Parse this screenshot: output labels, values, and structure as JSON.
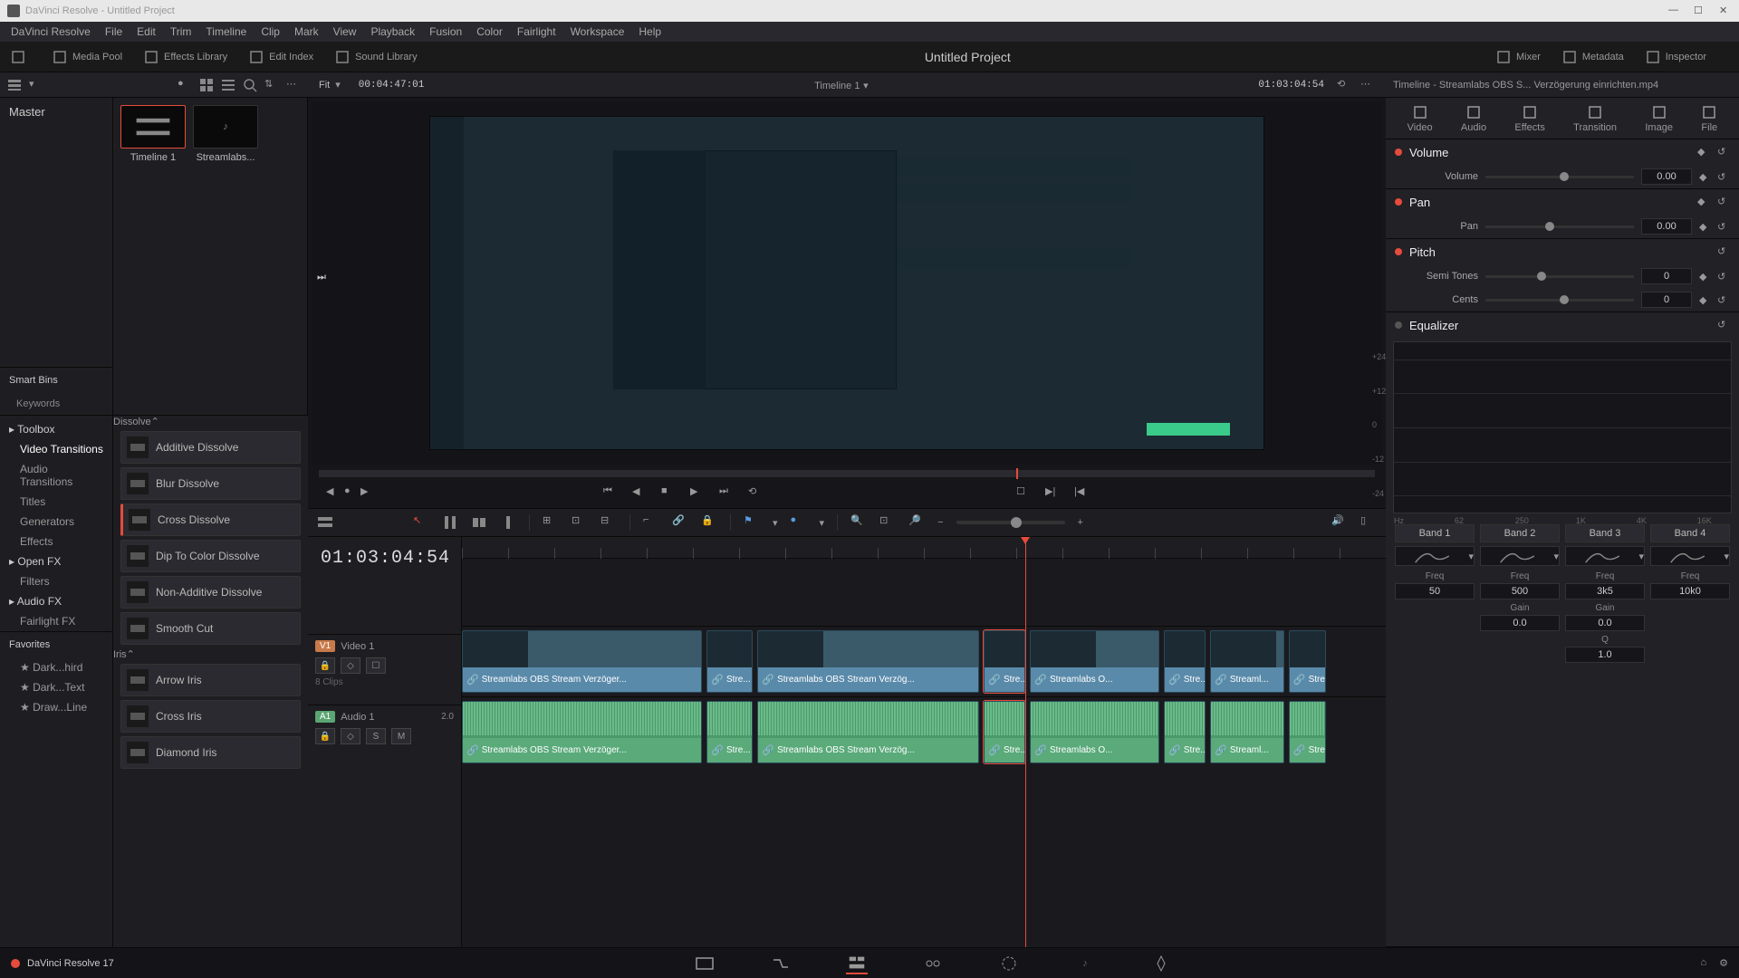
{
  "window": {
    "title": "DaVinci Resolve - Untitled Project"
  },
  "menubar": [
    "DaVinci Resolve",
    "File",
    "Edit",
    "Trim",
    "Timeline",
    "Clip",
    "Mark",
    "View",
    "Playback",
    "Fusion",
    "Color",
    "Fairlight",
    "Workspace",
    "Help"
  ],
  "topnav": {
    "left": [
      {
        "icon": "panel-left-icon",
        "label": ""
      },
      {
        "icon": "media-pool-icon",
        "label": "Media Pool"
      },
      {
        "icon": "effects-library-icon",
        "label": "Effects Library"
      },
      {
        "icon": "edit-index-icon",
        "label": "Edit Index"
      },
      {
        "icon": "sound-library-icon",
        "label": "Sound Library"
      }
    ],
    "project_title": "Untitled Project",
    "right": [
      {
        "icon": "mixer-icon",
        "label": "Mixer"
      },
      {
        "icon": "metadata-icon",
        "label": "Metadata"
      },
      {
        "icon": "inspector-icon",
        "label": "Inspector"
      }
    ]
  },
  "workrow": {
    "fit": "Fit",
    "source_tc": "00:04:47:01",
    "timeline_name": "Timeline 1",
    "record_tc": "01:03:04:54",
    "inspector_title": "Timeline - Streamlabs OBS S... Verzögerung einrichten.mp4"
  },
  "mediapool": {
    "master": "Master",
    "thumbs": [
      {
        "label": "Timeline 1",
        "selected": true
      },
      {
        "label": "Streamlabs..."
      }
    ],
    "smartbins": {
      "header": "Smart Bins",
      "items": [
        "Keywords"
      ]
    }
  },
  "fxlib": {
    "tree": [
      {
        "label": "Toolbox",
        "kind": "hdr"
      },
      {
        "label": "Video Transitions",
        "kind": "sub",
        "active": true
      },
      {
        "label": "Audio Transitions",
        "kind": "sub"
      },
      {
        "label": "Titles",
        "kind": "sub"
      },
      {
        "label": "Generators",
        "kind": "sub"
      },
      {
        "label": "Effects",
        "kind": "sub"
      },
      {
        "label": "Open FX",
        "kind": "hdr"
      },
      {
        "label": "Filters",
        "kind": "sub"
      },
      {
        "label": "Audio FX",
        "kind": "hdr"
      },
      {
        "label": "Fairlight FX",
        "kind": "sub"
      }
    ],
    "favorites_hdr": "Favorites",
    "favorites": [
      "Dark...hird",
      "Dark...Text",
      "Draw...Line"
    ],
    "groups": [
      {
        "name": "Dissolve",
        "items": [
          {
            "label": "Additive Dissolve"
          },
          {
            "label": "Blur Dissolve"
          },
          {
            "label": "Cross Dissolve",
            "selected": true
          },
          {
            "label": "Dip To Color Dissolve"
          },
          {
            "label": "Non-Additive Dissolve"
          },
          {
            "label": "Smooth Cut"
          }
        ]
      },
      {
        "name": "Iris",
        "items": [
          {
            "label": "Arrow Iris"
          },
          {
            "label": "Cross Iris"
          },
          {
            "label": "Diamond Iris"
          }
        ]
      }
    ]
  },
  "viewer": {
    "playhead_percent": 66
  },
  "timeline": {
    "big_tc": "01:03:04:54",
    "video_track": {
      "tag": "V1",
      "name": "Video 1",
      "clips_label": "8 Clips"
    },
    "audio_track": {
      "tag": "A1",
      "name": "Audio 1",
      "ch": "2.0"
    },
    "playhead_percent": 61,
    "clips": [
      {
        "start": 0,
        "width": 26,
        "label": "Streamlabs OBS Stream Verzöger..."
      },
      {
        "start": 26.5,
        "width": 5,
        "label": "Stre..."
      },
      {
        "start": 32,
        "width": 24,
        "label": "Streamlabs OBS Stream Verzög..."
      },
      {
        "start": 56.5,
        "width": 4.5,
        "label": "Stre...",
        "selected": true
      },
      {
        "start": 61.5,
        "width": 14,
        "label": "Streamlabs O..."
      },
      {
        "start": 76,
        "width": 4.5,
        "label": "Stre..."
      },
      {
        "start": 81,
        "width": 8,
        "label": "Streaml..."
      },
      {
        "start": 89.5,
        "width": 4,
        "label": "Stre..."
      }
    ]
  },
  "inspector": {
    "tabs": [
      {
        "icon": "video-tab-icon",
        "label": "Video"
      },
      {
        "icon": "audio-tab-icon",
        "label": "Audio",
        "active": true
      },
      {
        "icon": "effects-tab-icon",
        "label": "Effects"
      },
      {
        "icon": "transition-tab-icon",
        "label": "Transition"
      },
      {
        "icon": "image-tab-icon",
        "label": "Image"
      },
      {
        "icon": "file-tab-icon",
        "label": "File"
      }
    ],
    "volume": {
      "header": "Volume",
      "label": "Volume",
      "value": "0.00",
      "knob": 50
    },
    "pan": {
      "header": "Pan",
      "label": "Pan",
      "value": "0.00",
      "knob": 40
    },
    "pitch": {
      "header": "Pitch",
      "rows": [
        {
          "label": "Semi Tones",
          "value": "0",
          "knob": 35
        },
        {
          "label": "Cents",
          "value": "0",
          "knob": 50
        }
      ]
    },
    "equalizer": {
      "header": "Equalizer",
      "axis_left": [
        "+24",
        "+12",
        "0",
        "-12",
        "-24"
      ],
      "axis_bottom": [
        "Hz",
        "62",
        "250",
        "1K",
        "4K",
        "16K"
      ],
      "bands": [
        {
          "name": "Band 1",
          "freq_label": "Freq",
          "freq": "50"
        },
        {
          "name": "Band 2",
          "freq_label": "Freq",
          "freq": "500",
          "gain_label": "Gain",
          "gain": "0.0"
        },
        {
          "name": "Band 3",
          "freq_label": "Freq",
          "freq": "3k5",
          "gain_label": "Gain",
          "gain": "0.0",
          "q_label": "Q",
          "q": "1.0"
        },
        {
          "name": "Band 4",
          "freq_label": "Freq",
          "freq": "10k0"
        }
      ]
    }
  },
  "pagebar": {
    "version": "DaVinci Resolve 17"
  }
}
